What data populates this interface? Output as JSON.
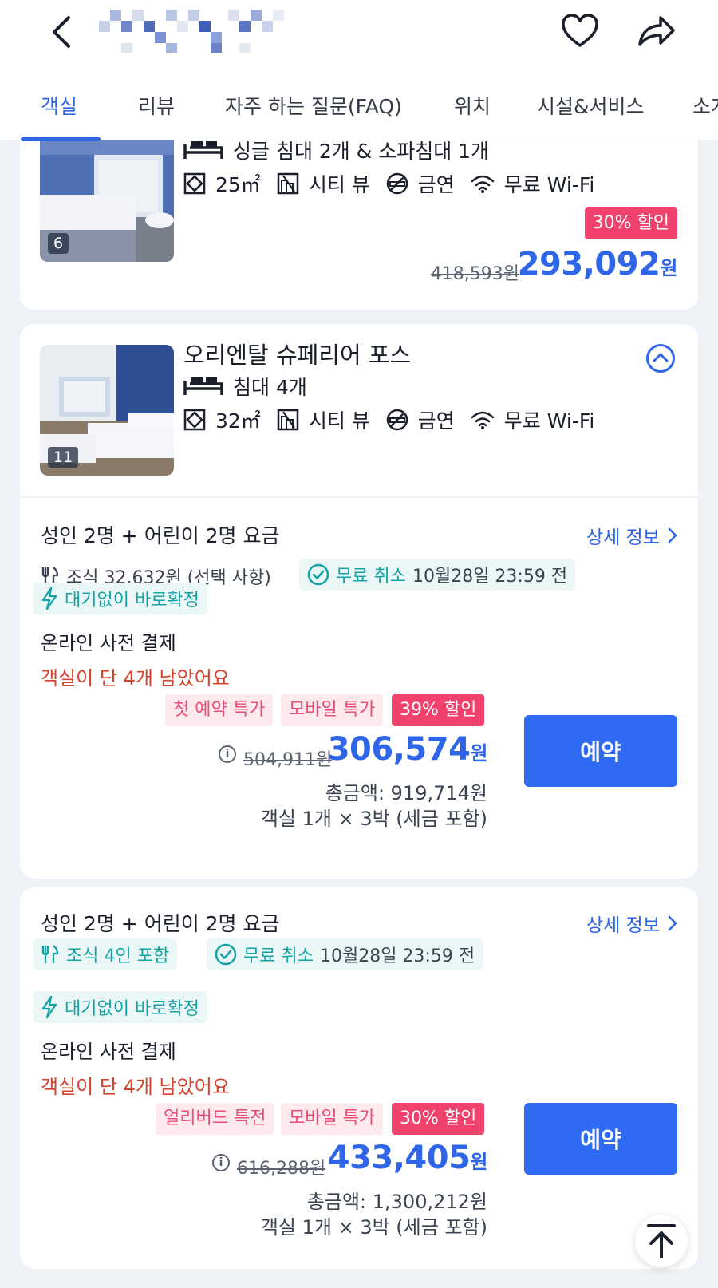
{
  "header": {
    "tabs": [
      "객실",
      "리뷰",
      "자주 하는 질문(FAQ)",
      "위치",
      "시설&서비스",
      "소개"
    ]
  },
  "rooms": [
    {
      "photo_count": "6",
      "beds": "싱글 침대 2개 & 소파침대 1개",
      "size": "25㎡",
      "view": "시티 뷰",
      "smoking": "금연",
      "wifi": "무료 Wi-Fi",
      "discount": "30% 할인",
      "original_price": "418,593원",
      "price": "293,092",
      "currency": "원"
    },
    {
      "photo_count": "11",
      "name": "오리엔탈 슈페리어 포스",
      "beds": "침대 4개",
      "size": "32㎡",
      "view": "시티 뷰",
      "smoking": "금연",
      "wifi": "무료 Wi-Fi"
    }
  ],
  "rates": [
    {
      "title": "성인 2명 + 어린이 2명 요금",
      "detail_link": "상세 정보",
      "breakfast": "조식 32,632원 (선택 사항)",
      "free_cancel": "무료 취소",
      "cancel_deadline": "10월28일 23:59 전",
      "instant_confirm": "대기없이 바로확정",
      "payment": "온라인 사전 결제",
      "scarcity": "객실이 단 4개 남았어요",
      "promos": [
        "첫 예약 특가",
        "모바일 특가",
        "39% 할인"
      ],
      "original_price": "504,911원",
      "price": "306,574",
      "currency": "원",
      "total": "총금액: 919,714원",
      "total_note": "객실 1개 × 3박 (세금 포함)",
      "reserve": "예약"
    },
    {
      "title": "성인 2명 + 어린이 2명 요금",
      "detail_link": "상세 정보",
      "breakfast": "조식 4인 포함",
      "free_cancel": "무료 취소",
      "cancel_deadline": "10월28일 23:59 전",
      "instant_confirm": "대기없이 바로확정",
      "payment": "온라인 사전 결제",
      "scarcity": "객실이 단 4개 남았어요",
      "promos": [
        "얼리버드 특전",
        "모바일 특가",
        "30% 할인"
      ],
      "original_price": "616,288원",
      "price": "433,405",
      "currency": "원",
      "total": "총금액: 1,300,212원",
      "total_note": "객실 1개 × 3박 (세금 포함)",
      "reserve": "예약"
    }
  ],
  "colors": {
    "accent": "#2f66e8",
    "discount": "#f0426d",
    "teal": "#14a3a5",
    "warning": "#d4402a"
  },
  "icons": [
    "back-arrow-icon",
    "heart-icon",
    "share-icon",
    "bed-icon",
    "area-icon",
    "city-view-icon",
    "no-smoking-icon",
    "wifi-icon",
    "chevron-up-icon",
    "breakfast-icon",
    "check-circle-icon",
    "lightning-icon",
    "info-icon",
    "scroll-to-top-icon"
  ]
}
